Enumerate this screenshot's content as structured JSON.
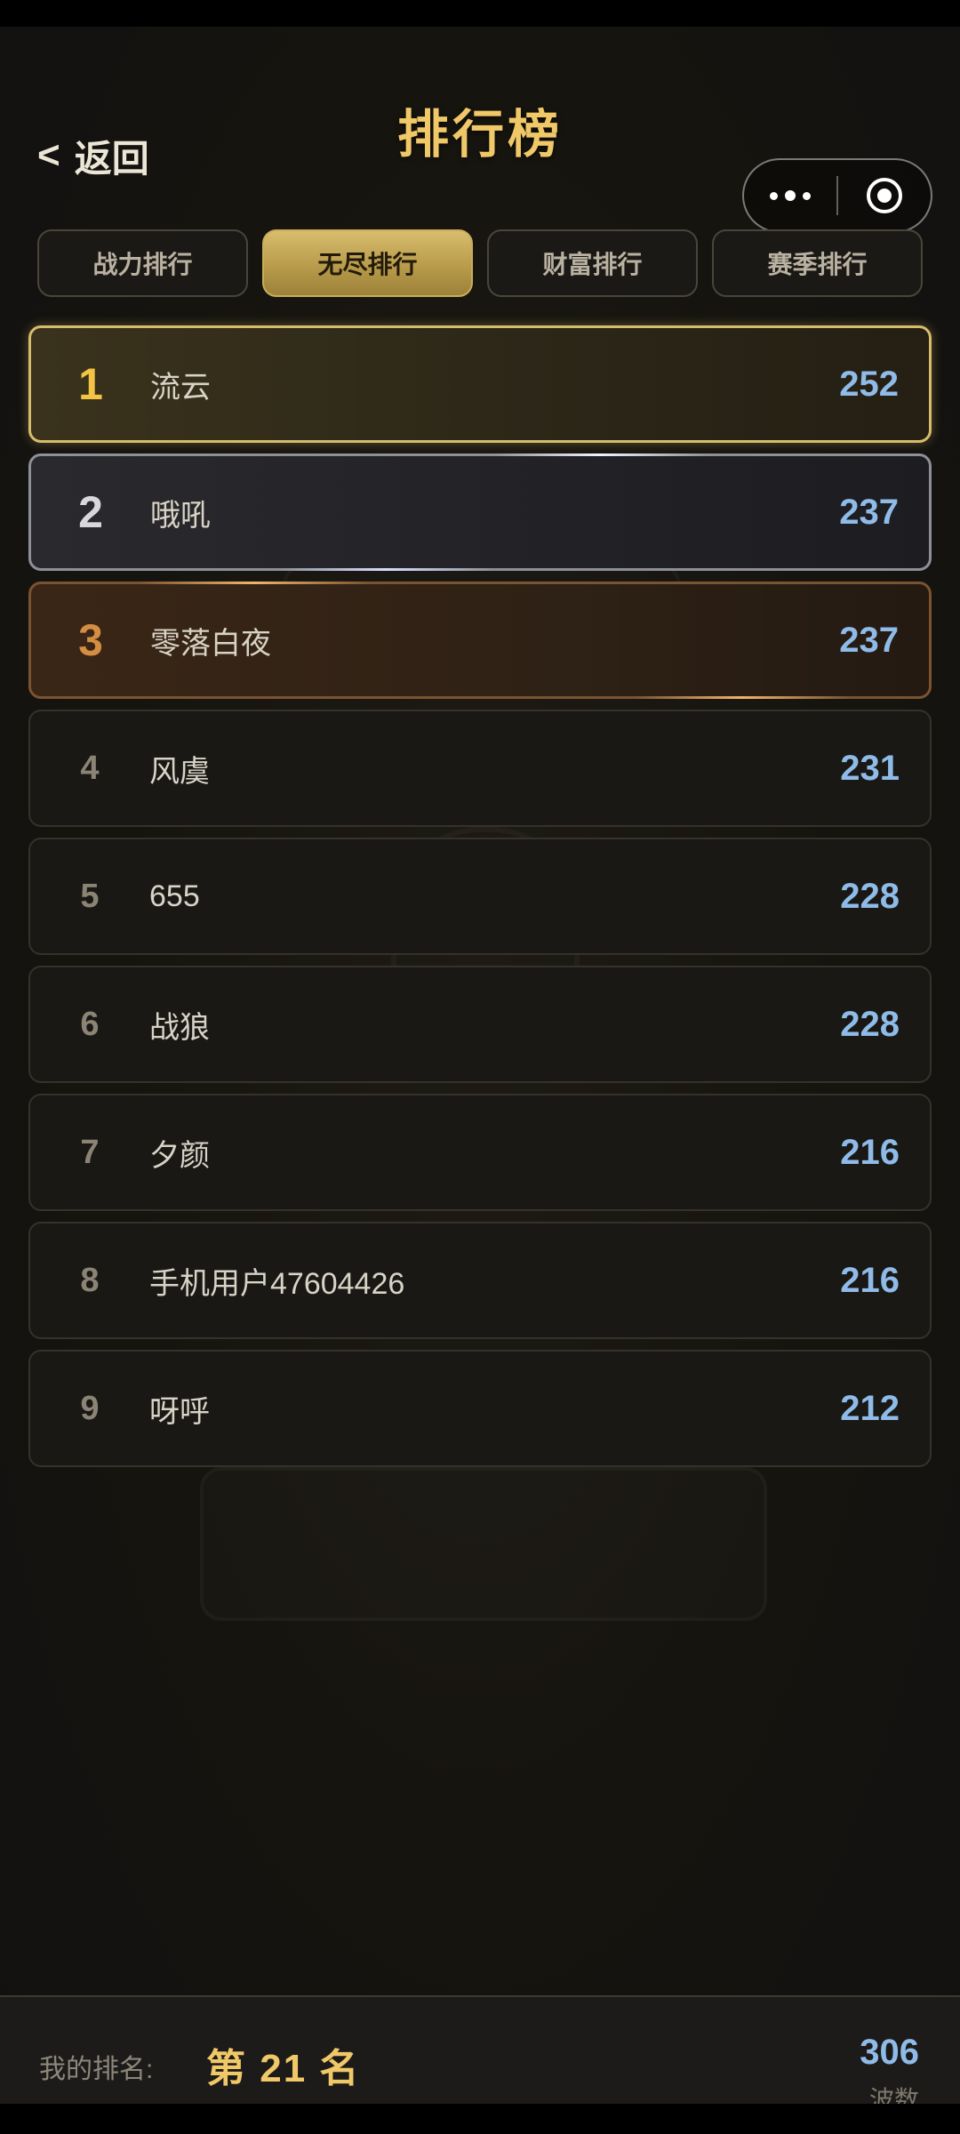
{
  "header": {
    "back_label": "返回",
    "title": "排行榜"
  },
  "tabs": [
    {
      "label": "战力排行",
      "active": false
    },
    {
      "label": "无尽排行",
      "active": true
    },
    {
      "label": "财富排行",
      "active": false
    },
    {
      "label": "赛季排行",
      "active": false
    }
  ],
  "ranking": [
    {
      "rank": "1",
      "name": "流云",
      "score": "252"
    },
    {
      "rank": "2",
      "name": "哦吼",
      "score": "237"
    },
    {
      "rank": "3",
      "name": "零落白夜",
      "score": "237"
    },
    {
      "rank": "4",
      "name": "风虞",
      "score": "231"
    },
    {
      "rank": "5",
      "name": "655",
      "score": "228"
    },
    {
      "rank": "6",
      "name": "战狼",
      "score": "228"
    },
    {
      "rank": "7",
      "name": "夕颜",
      "score": "216"
    },
    {
      "rank": "8",
      "name": "手机用户47604426",
      "score": "216"
    },
    {
      "rank": "9",
      "name": "呀呼",
      "score": "212"
    }
  ],
  "footer": {
    "my_rank_label": "我的排名:",
    "my_rank_value": "第 21 名",
    "my_score": "306",
    "score_unit": "波数"
  },
  "colors": {
    "gold": "#f0c868",
    "score_blue": "#8fbbe8",
    "first_place": "#f3c443",
    "second_place": "#d8d8dc",
    "third_place": "#d58c43"
  },
  "icons": {
    "back": "chevron-left-icon",
    "more": "more-dots-icon",
    "close": "target-circle-icon"
  }
}
